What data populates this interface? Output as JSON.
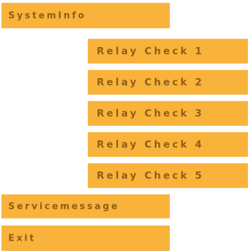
{
  "menu": {
    "items": [
      {
        "label": "SystemInfo"
      },
      {
        "label": "Relay Check 1"
      },
      {
        "label": "Relay Check 2"
      },
      {
        "label": "Relay Check 3"
      },
      {
        "label": "Relay Check 4"
      },
      {
        "label": "Relay Check 5"
      },
      {
        "label": "Servicemessage"
      },
      {
        "label": "Exit"
      }
    ]
  },
  "colors": {
    "item_background": "#f9b23a",
    "item_text": "#8f5f16",
    "page_background": "#ffffff"
  }
}
